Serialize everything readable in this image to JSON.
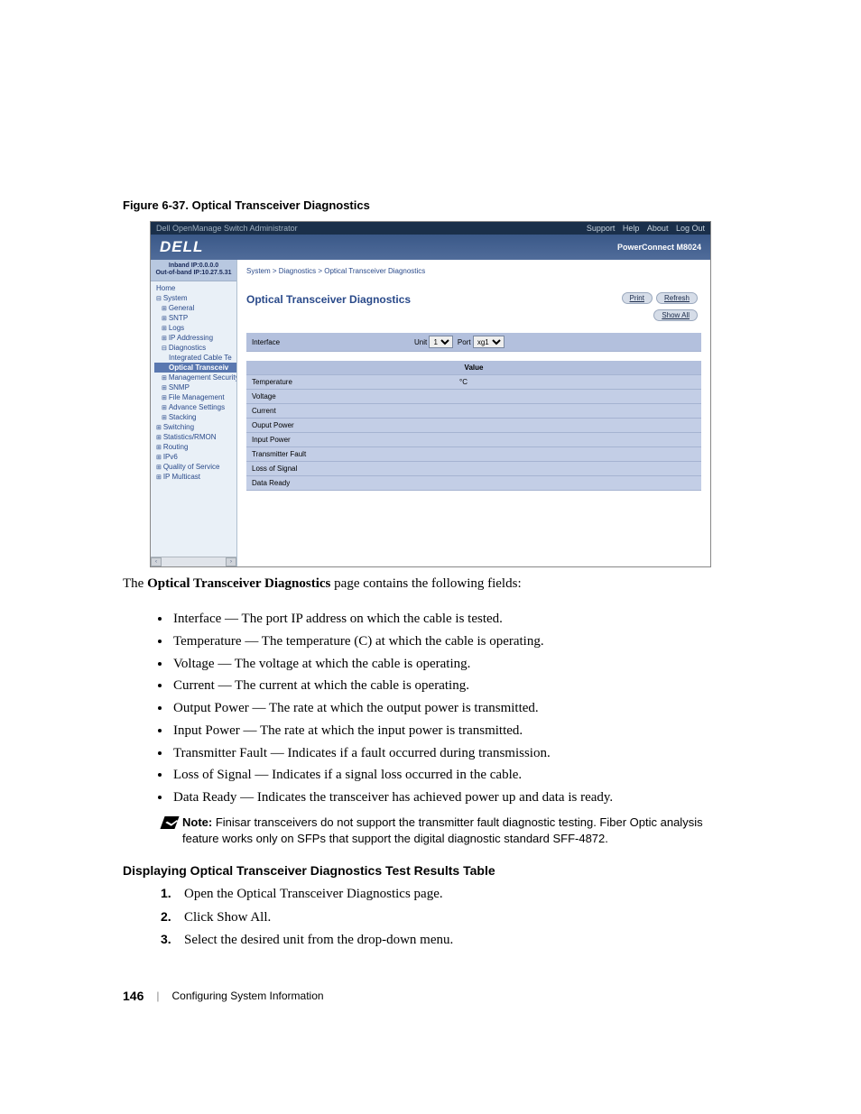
{
  "figure_caption": "Figure 6-37.    Optical Transceiver Diagnostics",
  "screenshot": {
    "topbar_left": "Dell OpenManage Switch Administrator",
    "topbar_links": [
      "Support",
      "Help",
      "About",
      "Log Out"
    ],
    "logo": "DELL",
    "product": "PowerConnect M8024",
    "ip_inband": "Inband IP:0.0.0.0",
    "ip_outband": "Out-of-band IP:10.27.5.31",
    "tree": [
      {
        "label": "Home",
        "level": 0,
        "class": ""
      },
      {
        "label": "System",
        "level": 0,
        "class": "col"
      },
      {
        "label": "General",
        "level": 1,
        "class": "exp"
      },
      {
        "label": "SNTP",
        "level": 1,
        "class": "exp"
      },
      {
        "label": "Logs",
        "level": 1,
        "class": "exp"
      },
      {
        "label": "IP Addressing",
        "level": 1,
        "class": "exp"
      },
      {
        "label": "Diagnostics",
        "level": 1,
        "class": "col"
      },
      {
        "label": "Integrated Cable Te",
        "level": 2,
        "class": ""
      },
      {
        "label": "Optical Transceiv",
        "level": 2,
        "class": "sel"
      },
      {
        "label": "Management Security",
        "level": 1,
        "class": "exp"
      },
      {
        "label": "SNMP",
        "level": 1,
        "class": "exp"
      },
      {
        "label": "File Management",
        "level": 1,
        "class": "exp"
      },
      {
        "label": "Advance Settings",
        "level": 1,
        "class": "exp"
      },
      {
        "label": "Stacking",
        "level": 1,
        "class": "exp"
      },
      {
        "label": "Switching",
        "level": 0,
        "class": "exp"
      },
      {
        "label": "Statistics/RMON",
        "level": 0,
        "class": "exp"
      },
      {
        "label": "Routing",
        "level": 0,
        "class": "exp"
      },
      {
        "label": "IPv6",
        "level": 0,
        "class": "exp"
      },
      {
        "label": "Quality of Service",
        "level": 0,
        "class": "exp"
      },
      {
        "label": "IP Multicast",
        "level": 0,
        "class": "exp"
      }
    ],
    "breadcrumb": "System > Diagnostics > Optical Transceiver Diagnostics",
    "page_title": "Optical Transceiver Diagnostics",
    "buttons": {
      "print": "Print",
      "refresh": "Refresh",
      "show_all": "Show All"
    },
    "interface_label": "Interface",
    "unit_label": "Unit",
    "unit_value": "1",
    "port_label": "Port",
    "port_value": "xg1",
    "value_header": "Value",
    "rows": [
      {
        "k": "Temperature",
        "v": "°C"
      },
      {
        "k": "Voltage",
        "v": ""
      },
      {
        "k": "Current",
        "v": ""
      },
      {
        "k": "Ouput Power",
        "v": ""
      },
      {
        "k": "Input Power",
        "v": ""
      },
      {
        "k": "Transmitter Fault",
        "v": ""
      },
      {
        "k": "Loss of Signal",
        "v": ""
      },
      {
        "k": "Data Ready",
        "v": ""
      }
    ]
  },
  "intro_prefix": "The ",
  "intro_bold": "Optical Transceiver Diagnostics",
  "intro_suffix": " page contains the following fields:",
  "fields": [
    {
      "name": "Interface",
      "desc": " — The port IP address on which the cable is tested."
    },
    {
      "name": "Temperature",
      "desc": " — The temperature (C) at which the cable is operating."
    },
    {
      "name": "Voltage",
      "desc": " — The voltage at which the cable is operating."
    },
    {
      "name": "Current",
      "desc": " — The current at which the cable is operating."
    },
    {
      "name": "Output Power — ",
      "desc": "The rate at which the output power is transmitted."
    },
    {
      "name": "Input Power — ",
      "desc": "The rate at which the input power is transmitted."
    },
    {
      "name": "Transmitter Fault — ",
      "desc": "Indicates if a fault occurred during transmission."
    },
    {
      "name": "Loss of Signal",
      "desc": " — Indicates if a signal loss occurred in the cable."
    },
    {
      "name": "Data Ready",
      "desc": " — Indicates the transceiver has achieved power up and data is ready."
    }
  ],
  "note_label": "Note: ",
  "note_text": "Finisar transceivers do not support the transmitter fault diagnostic testing. Fiber Optic analysis feature works only on SFPs that support the digital diagnostic standard SFF-4872.",
  "section_heading": "Displaying Optical Transceiver Diagnostics Test Results Table",
  "steps": [
    {
      "pre": "Open the ",
      "bold": "Optical Transceiver Diagnostics",
      "post": " page."
    },
    {
      "pre": "Click ",
      "bold": "Show All",
      "post": "."
    },
    {
      "pre": "Select the desired unit from the drop-down menu.",
      "bold": "",
      "post": ""
    }
  ],
  "footer": {
    "page": "146",
    "section": "Configuring System Information"
  }
}
